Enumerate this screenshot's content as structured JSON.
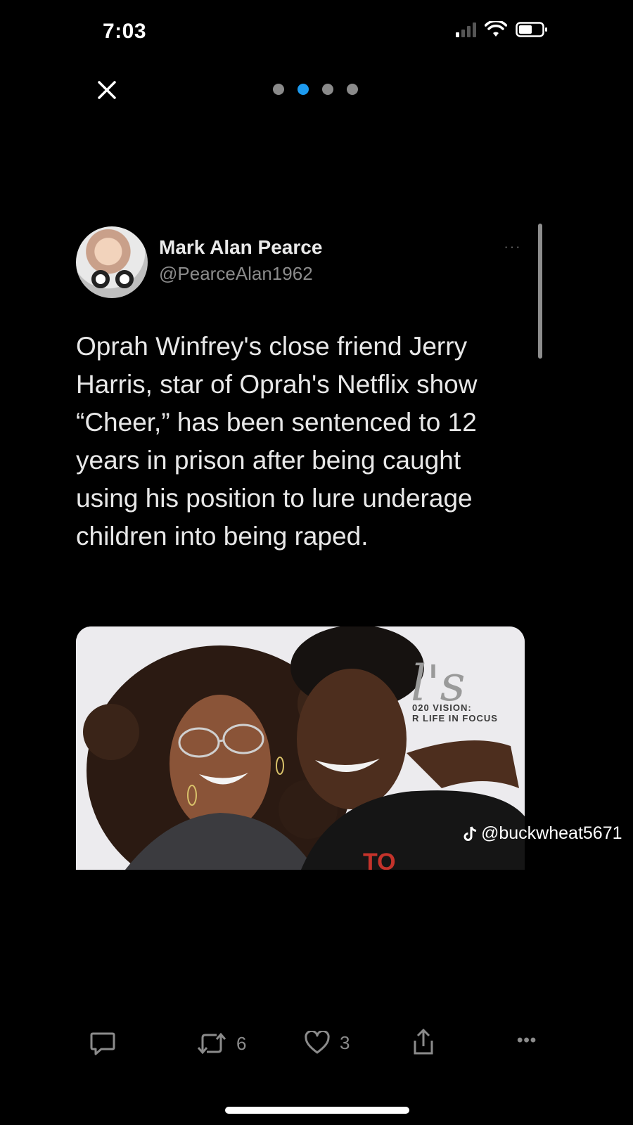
{
  "status_bar": {
    "time": "7:03"
  },
  "carousel": {
    "dots": 4,
    "active_index": 1,
    "active_color": "#1d9bf0"
  },
  "tweet": {
    "author_name": "Mark Alan Pearce",
    "author_handle": "@PearceAlan1962",
    "more_label": "···",
    "text": "Oprah Winfrey's close friend Jerry Harris, star of Oprah's Netflix show “Cheer,” has been sentenced to 12 years in prison after being caught using his position to lure underage children into being raped.",
    "media": {
      "backdrop_logo": "l's",
      "backdrop_line1": "020 VISION:",
      "backdrop_line2": "R LIFE IN FOCUS",
      "shirt_text": "TO"
    }
  },
  "watermark": {
    "icon": "tiktok-icon",
    "text": "@buckwheat5671"
  },
  "actions": {
    "reply_icon": "comment-icon",
    "retweet_icon": "retweet-icon",
    "retweet_count": "6",
    "like_icon": "heart-icon",
    "like_count": "3",
    "share_icon": "share-icon",
    "more_label": "•••"
  }
}
